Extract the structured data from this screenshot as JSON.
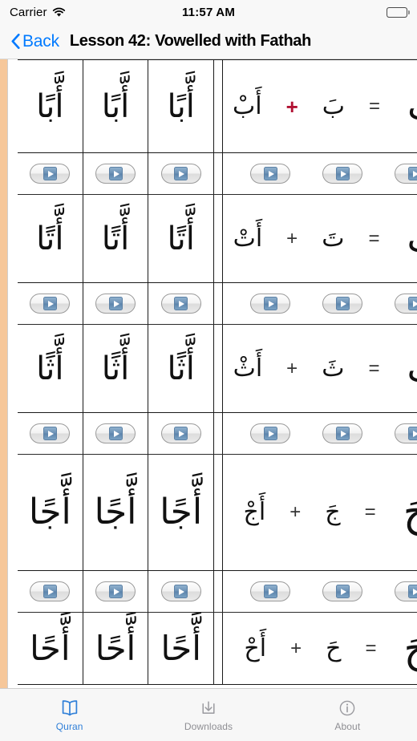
{
  "status_bar": {
    "carrier": "Carrier",
    "wifi_icon": "wifi-icon",
    "time": "11:57 AM",
    "battery_icon": "battery-full-icon"
  },
  "nav_bar": {
    "back_icon": "chevron-left-icon",
    "back_label": "Back",
    "title": "Lesson 42: Vowelled with Fathah"
  },
  "colors": {
    "accent_blue": "#007aff",
    "tab_active": "#2f7fd8",
    "tab_inactive": "#8e8e93",
    "page_edge": "#f6c79a",
    "diacritic_red": "#b11133",
    "grid_line": "#1a1a1a"
  },
  "lesson_table": {
    "play_icon": "play-icon",
    "rows": [
      {
        "type": "text",
        "practice": [
          "أَّبًا",
          "أَّبًا",
          "أَّبًا"
        ],
        "equation": {
          "result": "أَبَ",
          "equals": "=",
          "operand_1": "بَ",
          "plus": "+",
          "operand_2": "أَبْ"
        }
      },
      {
        "type": "audio",
        "left_buttons": 3,
        "right_buttons": 3
      },
      {
        "type": "text",
        "practice": [
          "أَّتًا",
          "أَّتًا",
          "أَّتًا"
        ],
        "equation": {
          "result": "أَتَ",
          "equals": "=",
          "operand_1": "تَ",
          "plus": "+",
          "operand_2": "أَتْ"
        }
      },
      {
        "type": "audio",
        "left_buttons": 3,
        "right_buttons": 3
      },
      {
        "type": "text",
        "practice": [
          "أَّثًا",
          "أَّثًا",
          "أَّثًا"
        ],
        "equation": {
          "result": "أَثَ",
          "equals": "=",
          "operand_1": "ثَ",
          "plus": "+",
          "operand_2": "أَثْ"
        }
      },
      {
        "type": "audio",
        "left_buttons": 3,
        "right_buttons": 3
      },
      {
        "type": "text",
        "practice": [
          "أَّجًا",
          "أَّجًا",
          "أَّجًا"
        ],
        "equation": {
          "result": "أَجَ",
          "equals": "=",
          "operand_1": "جَ",
          "plus": "+",
          "operand_2": "أَجْ"
        }
      },
      {
        "type": "audio",
        "left_buttons": 3,
        "right_buttons": 3
      },
      {
        "type": "text",
        "practice": [
          "أَّحًا",
          "أَّحًا",
          "أَّحًا"
        ],
        "equation": {
          "result": "أَحَ",
          "equals": "=",
          "operand_1": "حَ",
          "plus": "+",
          "operand_2": "أَحْ"
        }
      }
    ]
  },
  "tab_bar": {
    "tabs": [
      {
        "label": "Quran",
        "icon": "open-book-icon",
        "active": true
      },
      {
        "label": "Downloads",
        "icon": "download-icon",
        "active": false
      },
      {
        "label": "About",
        "icon": "info-circle-icon",
        "active": false
      }
    ]
  }
}
